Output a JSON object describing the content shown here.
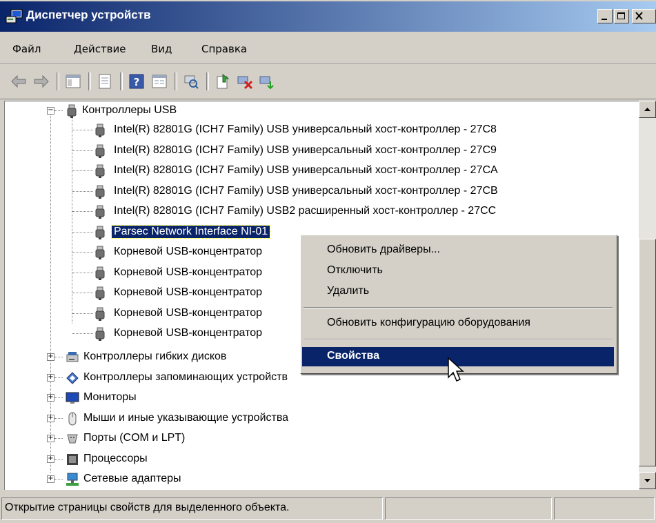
{
  "window": {
    "title": "Диспетчер устройств"
  },
  "menu": [
    "Файл",
    "Действие",
    "Вид",
    "Справка"
  ],
  "toolbar": [
    "back-icon",
    "forward-icon",
    "console-tree-icon",
    "properties-icon",
    "help-icon",
    "view-icon",
    "scan-hardware-icon",
    "update-driver-icon",
    "disable-device-icon",
    "uninstall-device-icon"
  ],
  "tree": {
    "usb_category": "Контроллеры USB",
    "usb_children": [
      "Intel(R) 82801G (ICH7 Family) USB универсальный хост-контроллер  - 27C8",
      "Intel(R) 82801G (ICH7 Family) USB универсальный хост-контроллер  - 27C9",
      "Intel(R) 82801G (ICH7 Family) USB универсальный хост-контроллер  - 27CA",
      "Intel(R) 82801G (ICH7 Family) USB универсальный хост-контроллер  - 27CB",
      "Intel(R) 82801G (ICH7 Family) USB2 расширенный хост-контроллер  - 27CC",
      "Parsec Network Interface NI-01",
      "Корневой USB-концентратор",
      "Корневой USB-концентратор",
      "Корневой USB-концентратор",
      "Корневой USB-концентратор",
      "Корневой USB-концентратор"
    ],
    "selected_index": 5,
    "categories": [
      "Контроллеры гибких дисков",
      "Контроллеры запоминающих устройств",
      "Мониторы",
      "Мыши и иные указывающие устройства",
      "Порты (COM и LPT)",
      "Процессоры",
      "Сетевые адаптеры"
    ]
  },
  "context_menu": {
    "items": [
      "Обновить драйверы...",
      "Отключить",
      "Удалить",
      "Обновить конфигурацию оборудования",
      "Свойства"
    ],
    "highlighted": "Свойства"
  },
  "status": {
    "text": "Открытие страницы свойств для выделенного объекта."
  },
  "colors": {
    "titlebar": "#0a246a",
    "selection": "#0a246a",
    "chrome": "#d4d0c8"
  }
}
